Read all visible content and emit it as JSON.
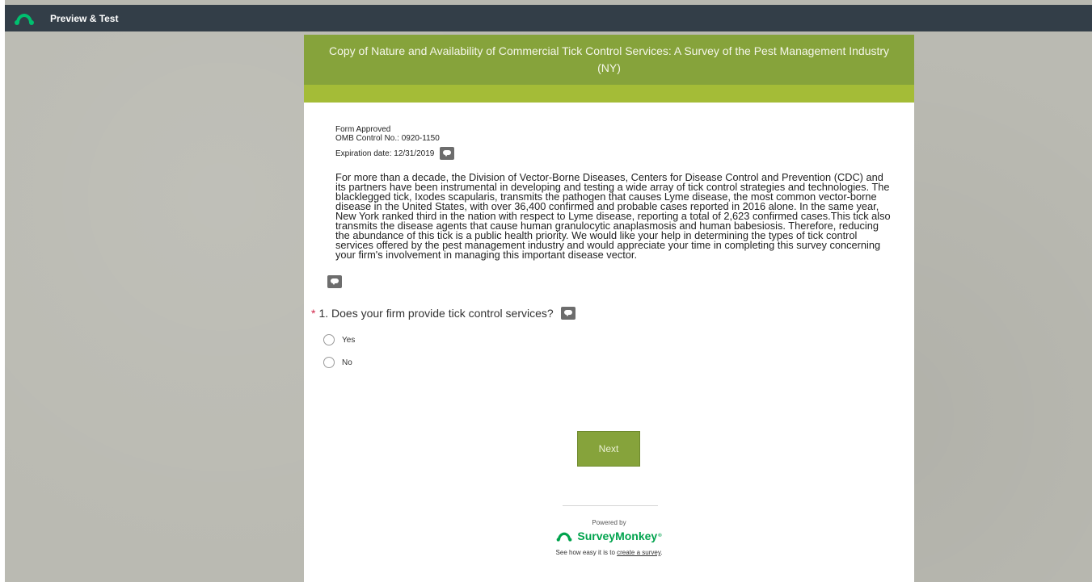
{
  "topbar": {
    "title": "Preview & Test",
    "logo_icon": "surveymonkey-logo-icon"
  },
  "survey": {
    "title": "Copy of Nature and Availability of Commercial Tick Control Services: A Survey of the Pest Management Industry (NY)",
    "header_color": "#86a33b",
    "band_color": "#a4bc37",
    "meta": {
      "line1": "Form Approved",
      "line2": "OMB Control No.: 0920-1150",
      "line3": "Expiration date: 12/31/2019"
    },
    "intro": "For more than a decade, the Division of Vector-Borne Diseases, Centers for Disease Control and Prevention (CDC) and its partners have been instrumental in developing and testing a wide array of tick control strategies and technologies. The blacklegged tick, Ixodes scapularis, transmits the pathogen that causes Lyme disease, the most common vector-borne disease in the United States, with over 36,400 confirmed and probable cases reported in 2016 alone. In the same year, New York ranked third in the nation with respect to Lyme disease, reporting a total of 2,623 confirmed cases.This tick also transmits the disease agents that cause human granulocytic anaplasmosis and human babesiosis. Therefore, reducing the abundance of this tick is a public health priority. We would like your help in determining the types of tick control services offered by the pest management industry and would appreciate your time in completing this survey concerning your firm's involvement in managing this important disease vector.",
    "question": {
      "required_marker": "*",
      "text": "1. Does your firm provide tick control services?",
      "options": [
        "Yes",
        "No"
      ]
    },
    "next_label": "Next"
  },
  "footer": {
    "powered_by": "Powered by",
    "brand": "SurveyMonkey",
    "brand_mark": "®",
    "tagline_prefix": "See how easy it is to ",
    "tagline_link": "create a survey",
    "tagline_suffix": "."
  },
  "colors": {
    "accent": "#86a33b",
    "brand_green": "#00a34d",
    "required": "#d1284b"
  }
}
